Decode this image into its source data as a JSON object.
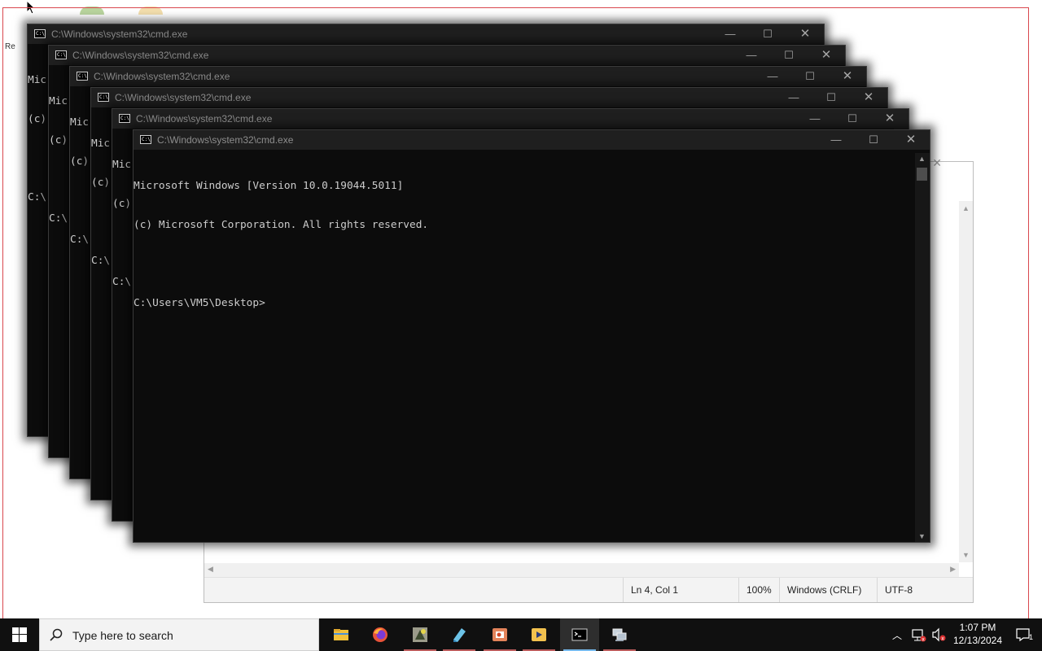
{
  "desktop": {
    "desktop_label_fragment": "Re"
  },
  "notepad": {
    "close_glyph": "✕",
    "status": {
      "position": "Ln 4, Col 1",
      "zoom": "100%",
      "line_ending": "Windows (CRLF)",
      "encoding": "UTF-8"
    }
  },
  "cmd_windows": [
    {
      "title": "C:\\Windows\\system32\\cmd.exe",
      "lines": [
        "Mic",
        "(c)",
        "",
        "C:\\"
      ]
    },
    {
      "title": "C:\\Windows\\system32\\cmd.exe",
      "lines": [
        "Mic",
        "(c)",
        "",
        "C:\\"
      ]
    },
    {
      "title": "C:\\Windows\\system32\\cmd.exe",
      "lines": [
        "Mic",
        "(c)",
        "",
        "C:\\"
      ]
    },
    {
      "title": "C:\\Windows\\system32\\cmd.exe",
      "lines": [
        "Mic",
        "(c)",
        "",
        "C:\\"
      ]
    },
    {
      "title": "C:\\Windows\\system32\\cmd.exe",
      "lines": [
        "Mic",
        "(c)",
        "",
        "C:\\"
      ]
    },
    {
      "title": "C:\\Windows\\system32\\cmd.exe",
      "lines": [
        "Microsoft Windows [Version 10.0.19044.5011]",
        "(c) Microsoft Corporation. All rights reserved.",
        "",
        "C:\\Users\\VM5\\Desktop>"
      ]
    }
  ],
  "window_buttons": {
    "minimize": "—",
    "maximize": "☐",
    "close": "✕"
  },
  "taskbar": {
    "search_placeholder": "Type here to search",
    "apps": [
      {
        "icon": "file-explorer-icon"
      },
      {
        "icon": "firefox-icon"
      },
      {
        "icon": "app-icon"
      },
      {
        "icon": "paint-icon"
      },
      {
        "icon": "powerpoint-icon"
      },
      {
        "icon": "media-player-icon"
      },
      {
        "icon": "command-prompt-icon",
        "active": true
      },
      {
        "icon": "network-icon"
      }
    ],
    "clock": {
      "time": "1:07 PM",
      "date": "12/13/2024"
    },
    "notification_count": "1"
  },
  "colors": {
    "console_bg": "#0c0c0c",
    "console_text": "#cccccc",
    "titlebar": "#1f1f1f",
    "taskbar": "#101010",
    "frame_accent": "#d9484e"
  }
}
